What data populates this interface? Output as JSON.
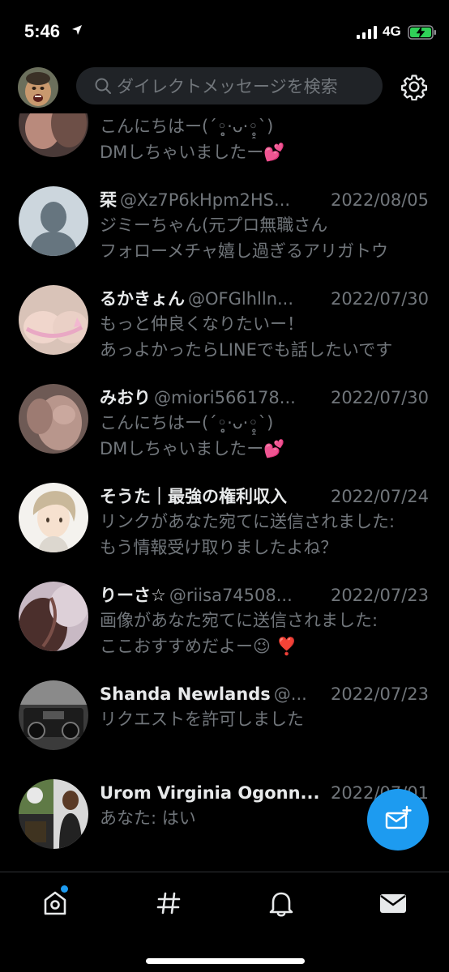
{
  "status_bar": {
    "time": "5:46",
    "network": "4G"
  },
  "header": {
    "search_placeholder": "ダイレクトメッセージを検索"
  },
  "conversations": [
    {
      "name": "",
      "handle": "",
      "date": "",
      "line1": "こんにちはー(´◦̥̥̥̥̥̥̥̥·ᴗ·◦̥̥̥̥̥̥̥̥`)",
      "line2": "DMしちゃいましたー💕"
    },
    {
      "name": "栞",
      "handle": "@Xz7P6kHpm2HS...",
      "date": "2022/08/05",
      "line1": "ジミーちゃん(元プロ無職さん",
      "line2": "フォローメチャ嬉し過ぎるアリガトウ"
    },
    {
      "name": "るかきょん",
      "handle": "@OFGlhlln...",
      "date": "2022/07/30",
      "line1": "もっと仲良くなりたいー！",
      "line2": "あっよかったらLINEでも話したいです"
    },
    {
      "name": "みおり",
      "handle": "@miori566178...",
      "date": "2022/07/30",
      "line1": "こんにちはー(´◦̥̥̥̥̥̥̥̥·ᴗ·◦̥̥̥̥̥̥̥̥`)",
      "line2": "DMしちゃいましたー💕"
    },
    {
      "name": "そうた｜最強の権利収入",
      "handle": "",
      "date": "2022/07/24",
      "line1": "リンクがあなた宛てに送信されました:",
      "line2": "もう情報受け取りましたよね？"
    },
    {
      "name": "りーさ☆",
      "handle": "@riisa74508...",
      "date": "2022/07/23",
      "line1": "画像があなた宛てに送信されました:",
      "line2": "ここおすすめだよー😉 ❣️"
    },
    {
      "name": "Shanda Newlands",
      "handle": "@...",
      "date": "2022/07/23",
      "line1": "リクエストを許可しました",
      "line2": ""
    },
    {
      "name": "Urom Virginia Ogonn...",
      "handle": "",
      "date": "2022/07/01",
      "line1": "あなた: はい",
      "line2": ""
    }
  ],
  "colors": {
    "accent": "#1d9bf0",
    "background": "#000000",
    "muted": "#71767b",
    "text": "#e7e9ea"
  },
  "icons": {
    "header": [
      "avatar",
      "search-icon",
      "gear-icon"
    ],
    "tabs": [
      "home-icon",
      "hashtag-icon",
      "bell-icon",
      "mail-icon"
    ],
    "fab": "new-message-icon"
  }
}
